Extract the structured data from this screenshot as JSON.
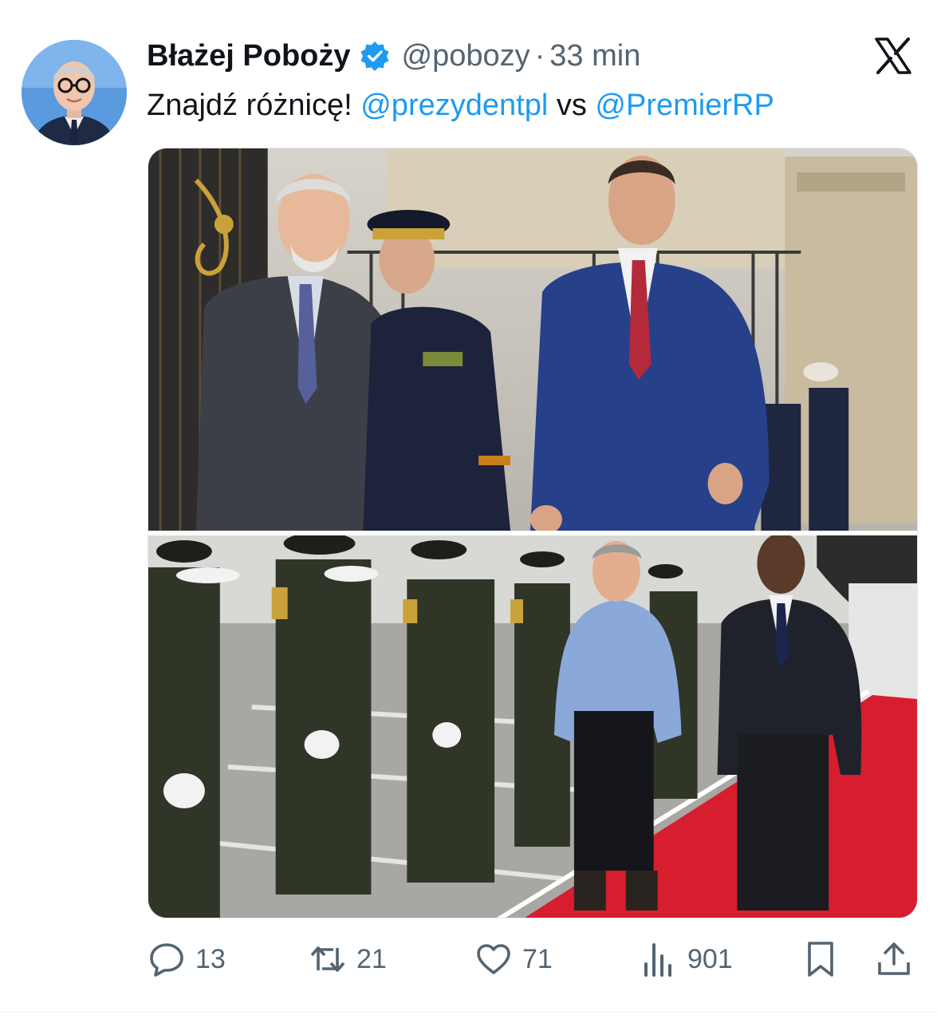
{
  "tweet": {
    "author": {
      "display_name": "Błażej Poboży",
      "handle": "@pobozy",
      "verified": true,
      "avatar_icon": "user-avatar"
    },
    "separator": "·",
    "time": "33 min",
    "text": {
      "lead": "Znajdź różnicę!",
      "mention_1": "@prezydentpl",
      "connector": "vs",
      "mention_2": "@PremierRP"
    },
    "media": {
      "count": 2,
      "top_photo": "ceremonial-welcome-photo",
      "bottom_photo": "airport-welcome-photo"
    },
    "actions": {
      "replies": "13",
      "reposts": "21",
      "likes": "71",
      "views": "901"
    }
  },
  "colors": {
    "accent": "#1d9bf0",
    "text_primary": "#0f1419",
    "text_secondary": "#536471",
    "verified_badge": "#1d9bf0"
  },
  "icons": {
    "platform_logo": "x-logo-icon",
    "reply": "speech-bubble-icon",
    "repost": "repost-arrows-icon",
    "like": "heart-icon",
    "views": "bar-chart-icon",
    "bookmark": "bookmark-icon",
    "share": "share-upload-icon"
  }
}
